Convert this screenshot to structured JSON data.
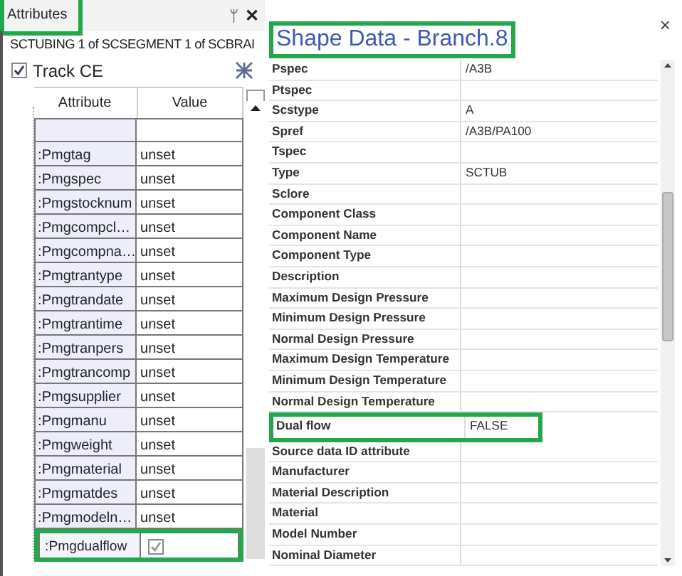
{
  "attributes_panel": {
    "title": "Attributes",
    "title_highlighted": true,
    "pin": "ᛘ",
    "close": "✕",
    "subtitle": "SCTUBING 1 of SCSEGMENT 1 of SCBRAI",
    "track_ce": {
      "label": "Track CE",
      "checked": true
    },
    "columns": [
      "Attribute",
      "Value"
    ],
    "rows": [
      {
        "kind": "text",
        "name": "",
        "value": "",
        "highlighted": false
      },
      {
        "kind": "text",
        "name": ":Pmgtag",
        "value": "unset",
        "highlighted": false
      },
      {
        "kind": "text",
        "name": ":Pmgspec",
        "value": "unset",
        "highlighted": false
      },
      {
        "kind": "text",
        "name": ":Pmgstocknum",
        "value": "unset",
        "highlighted": false
      },
      {
        "kind": "text",
        "name": ":Pmgcompcl…",
        "value": "unset",
        "highlighted": false
      },
      {
        "kind": "text",
        "name": ":Pmgcompna…",
        "value": "unset",
        "highlighted": false
      },
      {
        "kind": "text",
        "name": ":Pmgtrantype",
        "value": "unset",
        "highlighted": false
      },
      {
        "kind": "text",
        "name": ":Pmgtrandate",
        "value": "unset",
        "highlighted": false
      },
      {
        "kind": "text",
        "name": ":Pmgtrantime",
        "value": "unset",
        "highlighted": false
      },
      {
        "kind": "text",
        "name": ":Pmgtranpers",
        "value": "unset",
        "highlighted": false
      },
      {
        "kind": "text",
        "name": ":Pmgtrancomp",
        "value": "unset",
        "highlighted": false
      },
      {
        "kind": "text",
        "name": ":Pmgsupplier",
        "value": "unset",
        "highlighted": false
      },
      {
        "kind": "text",
        "name": ":Pmgmanu",
        "value": "unset",
        "highlighted": false
      },
      {
        "kind": "text",
        "name": ":Pmgweight",
        "value": "unset",
        "highlighted": false
      },
      {
        "kind": "text",
        "name": ":Pmgmaterial",
        "value": "unset",
        "highlighted": false
      },
      {
        "kind": "text",
        "name": ":Pmgmatdes",
        "value": "unset",
        "highlighted": false
      },
      {
        "kind": "text",
        "name": ":Pmgmodeln…",
        "value": "unset",
        "highlighted": false
      },
      {
        "kind": "checkbox",
        "name": ":Pmgdualflow",
        "checked": true,
        "highlighted": true
      }
    ]
  },
  "shape_data": {
    "title": "Shape Data - Branch.8",
    "title_highlighted": true,
    "close": "×",
    "rows": [
      {
        "label": "Pspec",
        "value": "/A3B",
        "highlighted": false
      },
      {
        "label": "Ptspec",
        "highlighted": false
      },
      {
        "label": "Scstype",
        "value": "A",
        "highlighted": false
      },
      {
        "label": "Spref",
        "value": "/A3B/PA100",
        "highlighted": false
      },
      {
        "label": "Tspec",
        "highlighted": false
      },
      {
        "label": "Type",
        "value": "SCTUB",
        "highlighted": false
      },
      {
        "label": "Sclore",
        "highlighted": false
      },
      {
        "label": "Component Class",
        "highlighted": false
      },
      {
        "label": "Component Name",
        "highlighted": false
      },
      {
        "label": "Component Type",
        "highlighted": false
      },
      {
        "label": "Description",
        "highlighted": false
      },
      {
        "label": "Maximum Design Pressure",
        "highlighted": false
      },
      {
        "label": "Minimum Design Pressure",
        "highlighted": false
      },
      {
        "label": "Normal Design Pressure",
        "highlighted": false
      },
      {
        "label": "Maximum Design Temperature",
        "highlighted": false
      },
      {
        "label": "Minimum Design Temperature",
        "highlighted": false
      },
      {
        "label": "Normal Design Temperature",
        "highlighted": false
      },
      {
        "label": "Dual flow",
        "value": "FALSE",
        "highlighted": true
      },
      {
        "label": "Source data ID attribute",
        "highlighted": false
      },
      {
        "label": "Manufacturer",
        "highlighted": false
      },
      {
        "label": "Material Description",
        "highlighted": false
      },
      {
        "label": "Material",
        "highlighted": false
      },
      {
        "label": "Model Number",
        "highlighted": false
      },
      {
        "label": "Nominal Diameter",
        "highlighted": false
      }
    ]
  }
}
